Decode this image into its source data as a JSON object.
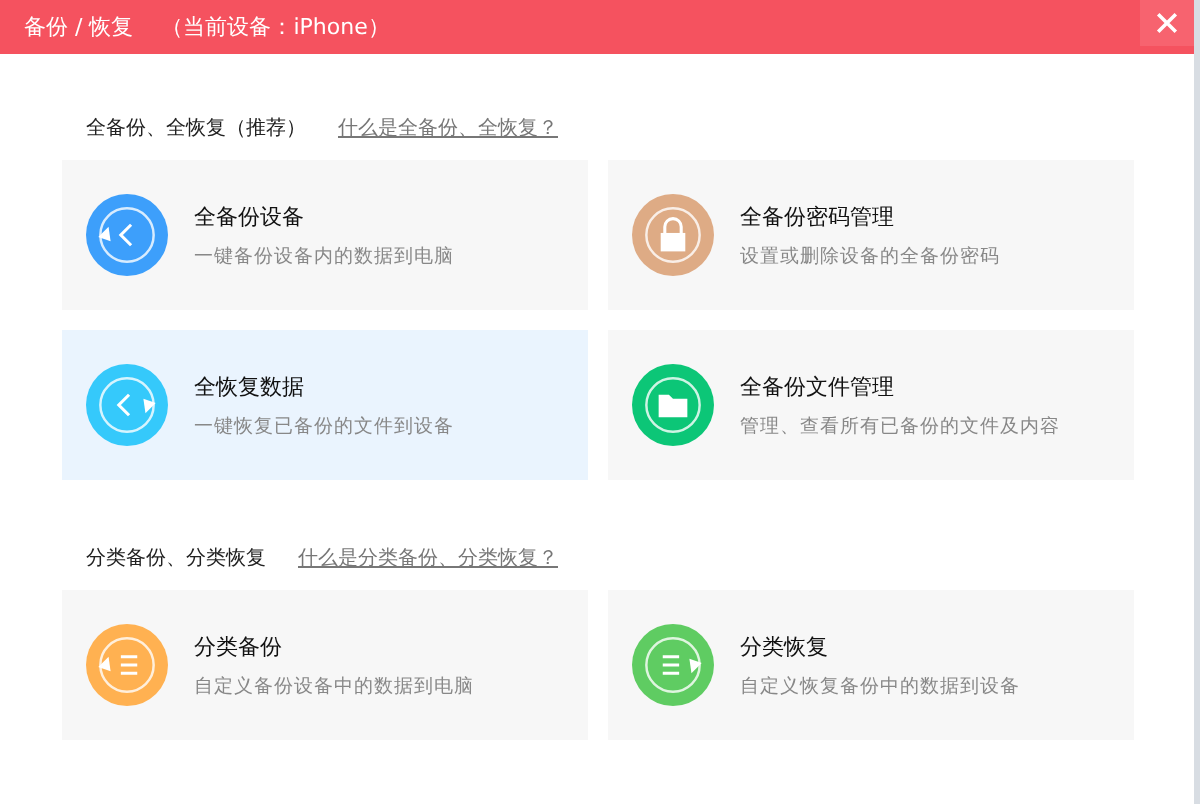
{
  "window": {
    "title": "备份 / 恢复",
    "device_label": "（当前设备：iPhone）"
  },
  "sections": [
    {
      "heading": "全备份、全恢复（推荐）",
      "help_link": "什么是全备份、全恢复？",
      "cards": [
        {
          "kind": "backup",
          "color": "#3d9ffb",
          "title": "全备份设备",
          "description": "一键备份设备内的数据到电脑",
          "selected": false
        },
        {
          "kind": "lock",
          "color": "#deab85",
          "title": "全备份密码管理",
          "description": "设置或删除设备的全备份密码",
          "selected": false
        },
        {
          "kind": "restore",
          "color": "#35c9fb",
          "title": "全恢复数据",
          "description": "一键恢复已备份的文件到设备",
          "selected": true
        },
        {
          "kind": "folder",
          "color": "#0cc677",
          "title": "全备份文件管理",
          "description": "管理、查看所有已备份的文件及内容",
          "selected": false
        }
      ]
    },
    {
      "heading": "分类备份、分类恢复",
      "help_link": "什么是分类备份、分类恢复？",
      "cards": [
        {
          "kind": "list-backup",
          "color": "#ffb151",
          "title": "分类备份",
          "description": "自定义备份设备中的数据到电脑",
          "selected": false
        },
        {
          "kind": "list-restore",
          "color": "#5fcc62",
          "title": "分类恢复",
          "description": "自定义恢复备份中的数据到设备",
          "selected": false
        }
      ]
    }
  ]
}
